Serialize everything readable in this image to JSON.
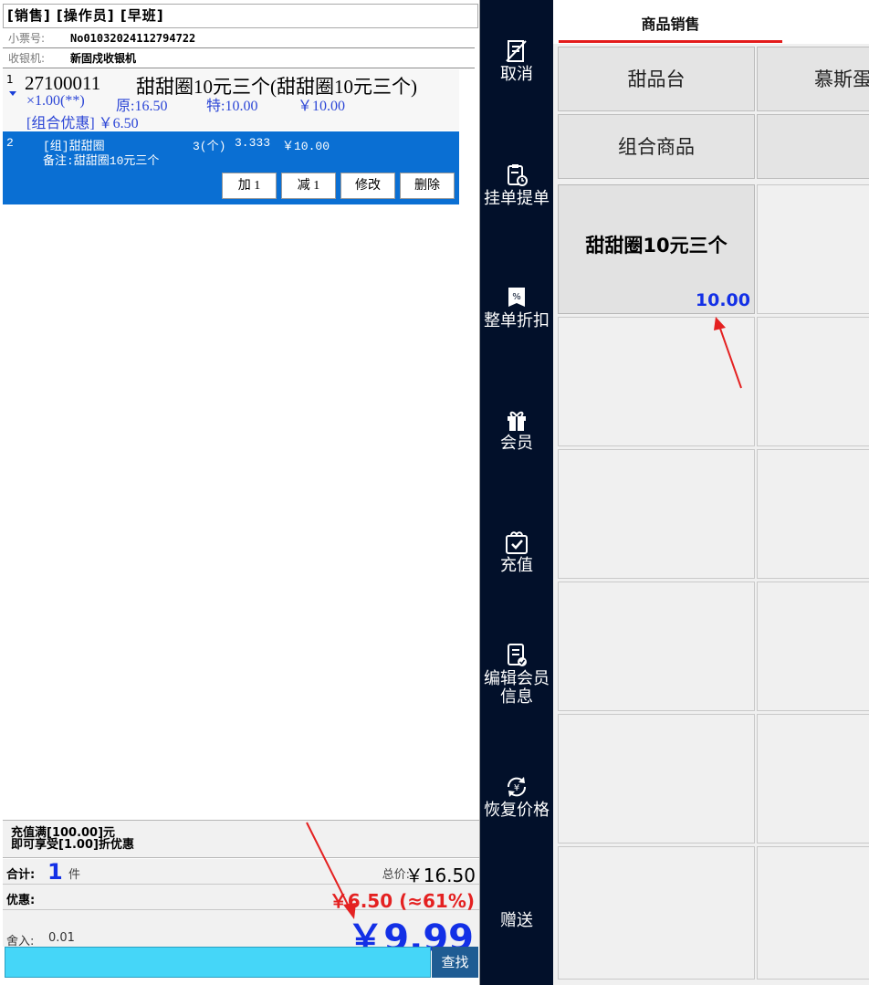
{
  "header": {
    "mode": "[销售] [操作员] [早班]",
    "receipt_label": "小票号:",
    "receipt_no": "No01032024112794722",
    "cashier_label": "收银机:",
    "cashier_name": "新固戍收银机"
  },
  "cart": {
    "item1": {
      "index": "1",
      "code": "27100011",
      "name": "甜甜圈10元三个(甜甜圈10元三个)",
      "qty": "×1.00(**)",
      "orig": "原:16.50",
      "special": "特:10.00",
      "price": "￥10.00",
      "combo": "[组合优惠] ￥6.50"
    },
    "item2": {
      "index": "2",
      "name": "[组]甜甜圈",
      "qty": "3(个)",
      "unit_price": "3.333",
      "amount": "￥10.00",
      "note": "备注:甜甜圈10元三个"
    },
    "buttons": {
      "add": "加 1",
      "minus": "减 1",
      "edit": "修改",
      "delete": "删除"
    }
  },
  "summary": {
    "promo_line1": "充值满[100.00]元",
    "promo_line2": "即可享受[1.00]折优惠",
    "count_label": "合计:",
    "count": "1",
    "count_unit": "件",
    "total_label": "总价:",
    "total": "￥16.50",
    "discount_label": "优惠:",
    "discount": "￥6.50 (≈61%)",
    "rounding_label": "舍入:",
    "rounding": "0.01",
    "payable": "￥9.99"
  },
  "search": {
    "button": "查找",
    "value": ""
  },
  "sidebar": {
    "cancel": "取消",
    "hold": "挂单提单",
    "discount": "整单折扣",
    "member": "会员",
    "recharge": "充值",
    "edit_member_1": "编辑会员",
    "edit_member_2": "信息",
    "restore_price": "恢复价格",
    "gift": "赠送"
  },
  "products": {
    "tab": "商品销售",
    "categories": [
      "甜品台",
      "慕斯蛋",
      "组合商品"
    ],
    "item_name": "甜甜圈10元三个",
    "item_price": "10.00"
  },
  "colors": {
    "accent_blue": "#0a6fd3",
    "price_blue": "#1330e6",
    "discount_red": "#e42121",
    "sidebar_bg": "#02102a",
    "search_bg": "#45d6f8"
  }
}
